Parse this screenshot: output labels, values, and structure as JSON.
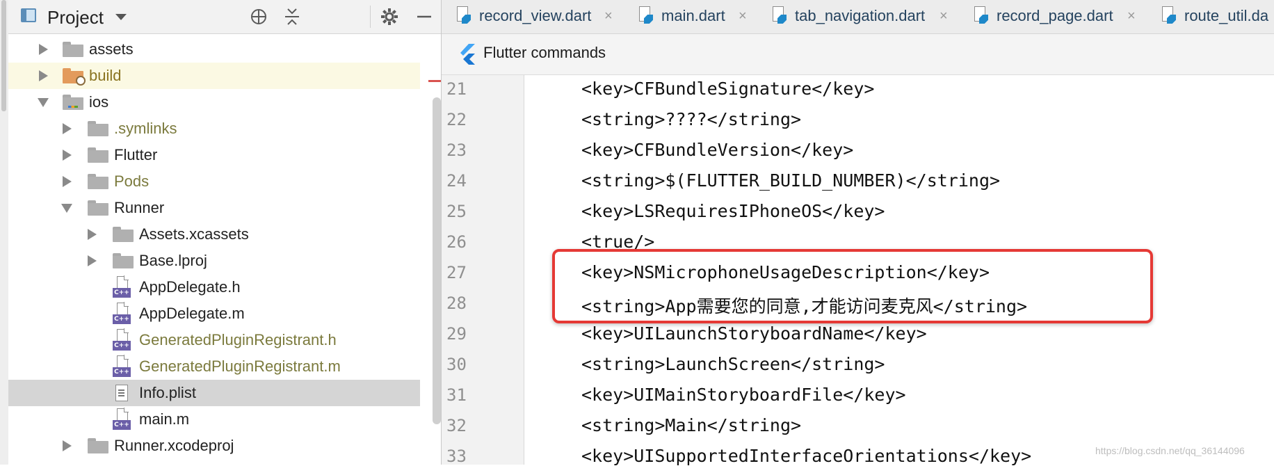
{
  "project_panel": {
    "title": "Project",
    "toolbar_icons": [
      "locate-icon",
      "collapse-icon",
      "gear-icon",
      "minimize-icon"
    ],
    "tree": [
      {
        "label": "assets",
        "kind": "folder",
        "expanded": false,
        "depth": 1,
        "state": "normal"
      },
      {
        "label": "build",
        "kind": "build-folder",
        "expanded": false,
        "depth": 1,
        "state": "excluded"
      },
      {
        "label": "ios",
        "kind": "module-folder",
        "expanded": true,
        "depth": 1,
        "state": "normal"
      },
      {
        "label": ".symlinks",
        "kind": "folder",
        "expanded": false,
        "depth": 2,
        "state": "ignored"
      },
      {
        "label": "Flutter",
        "kind": "folder",
        "expanded": false,
        "depth": 2,
        "state": "normal"
      },
      {
        "label": "Pods",
        "kind": "folder",
        "expanded": false,
        "depth": 2,
        "state": "ignored"
      },
      {
        "label": "Runner",
        "kind": "folder",
        "expanded": true,
        "depth": 2,
        "state": "normal"
      },
      {
        "label": "Assets.xcassets",
        "kind": "folder",
        "expanded": false,
        "depth": 3,
        "state": "normal"
      },
      {
        "label": "Base.lproj",
        "kind": "folder",
        "expanded": false,
        "depth": 3,
        "state": "normal"
      },
      {
        "label": "AppDelegate.h",
        "kind": "c-file",
        "depth": 3,
        "state": "normal"
      },
      {
        "label": "AppDelegate.m",
        "kind": "c-file",
        "depth": 3,
        "state": "normal"
      },
      {
        "label": "GeneratedPluginRegistrant.h",
        "kind": "c-file",
        "depth": 3,
        "state": "ignored"
      },
      {
        "label": "GeneratedPluginRegistrant.m",
        "kind": "c-file",
        "depth": 3,
        "state": "ignored"
      },
      {
        "label": "Info.plist",
        "kind": "plist-file",
        "depth": 3,
        "state": "selected"
      },
      {
        "label": "main.m",
        "kind": "c-file",
        "depth": 3,
        "state": "normal"
      },
      {
        "label": "Runner.xcodeproj",
        "kind": "folder",
        "expanded": false,
        "depth": 2,
        "state": "normal"
      }
    ]
  },
  "editor": {
    "tabs": [
      {
        "label": "record_view.dart",
        "icon": "dart-file-icon"
      },
      {
        "label": "main.dart",
        "icon": "dart-file-icon"
      },
      {
        "label": "tab_navigation.dart",
        "icon": "dart-file-icon"
      },
      {
        "label": "record_page.dart",
        "icon": "dart-file-icon"
      },
      {
        "label": "route_util.da",
        "icon": "dart-file-icon"
      }
    ],
    "close_glyph": "×",
    "flutter_bar": {
      "title": "Flutter commands"
    },
    "lines": [
      {
        "num": "21",
        "text": "<key>CFBundleSignature</key>"
      },
      {
        "num": "22",
        "text": "<string>????</string>"
      },
      {
        "num": "23",
        "text": "<key>CFBundleVersion</key>"
      },
      {
        "num": "24",
        "text": "<string>$(FLUTTER_BUILD_NUMBER)</string>"
      },
      {
        "num": "25",
        "text": "<key>LSRequiresIPhoneOS</key>"
      },
      {
        "num": "26",
        "text": "<true/>"
      },
      {
        "num": "27",
        "text": "<key>NSMicrophoneUsageDescription</key>"
      },
      {
        "num": "28",
        "text": "<string>App需要您的同意,才能访问麦克风</string>"
      },
      {
        "num": "29",
        "text": "<key>UILaunchStoryboardName</key>"
      },
      {
        "num": "30",
        "text": "<string>LaunchScreen</string>"
      },
      {
        "num": "31",
        "text": "<key>UIMainStoryboardFile</key>"
      },
      {
        "num": "32",
        "text": "<string>Main</string>"
      },
      {
        "num": "33",
        "text": "<key>UISupportedInterfaceOrientations</key>"
      }
    ],
    "highlighted_lines": [
      "27",
      "28"
    ]
  },
  "watermark": "https://blog.csdn.net/qq_36144096",
  "colors": {
    "accent_highlight": "#e53935",
    "ignored_text": "#7b7a3d",
    "tab_text": "#25435f",
    "selected_row": "#d5d5d5",
    "build_row": "#fbf9e3",
    "c_badge": "#6b5fa8",
    "flutter_blue": "#42a5f5"
  }
}
